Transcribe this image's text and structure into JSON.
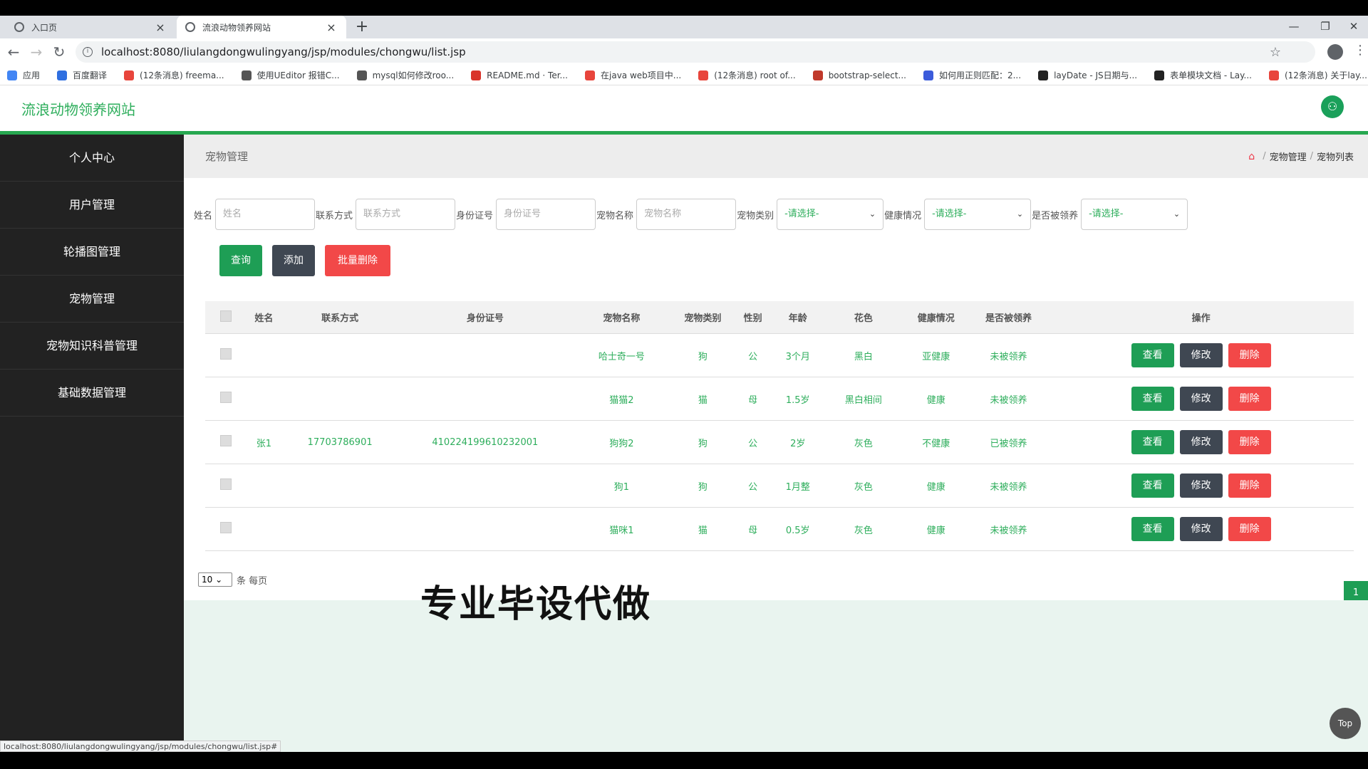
{
  "browser": {
    "tabs": [
      {
        "title": "入口页",
        "icon": "globe-icon"
      },
      {
        "title": "流浪动物领养网站",
        "icon": "site-icon"
      }
    ],
    "new_tab": "+",
    "url": "localhost:8080/liulangdongwulingyang/jsp/modules/chongwu/list.jsp",
    "bookmarks": [
      {
        "label": "应用",
        "color": "#4285f4"
      },
      {
        "label": "百度翻译",
        "color": "#2f6fe0"
      },
      {
        "label": "(12条消息) freema...",
        "color": "#e8453c"
      },
      {
        "label": "使用UEditor 报错C...",
        "color": "#555555"
      },
      {
        "label": "mysql如何修改roo...",
        "color": "#555555"
      },
      {
        "label": "README.md · Ter...",
        "color": "#d9342b"
      },
      {
        "label": "在java web项目中...",
        "color": "#e8453c"
      },
      {
        "label": "(12条消息) root of...",
        "color": "#e8453c"
      },
      {
        "label": "bootstrap-select...",
        "color": "#c0392b"
      },
      {
        "label": "如何用正则匹配：2...",
        "color": "#3b5bdb"
      },
      {
        "label": "layDate - JS日期与...",
        "color": "#222222"
      },
      {
        "label": "表单模块文档 - Lay...",
        "color": "#222222"
      },
      {
        "label": "(12条消息) 关于lay...",
        "color": "#e8453c"
      }
    ],
    "status_url": "localhost:8080/liulangdongwulingyang/jsp/modules/chongwu/list.jsp#"
  },
  "site": {
    "title": "流浪动物领养网站",
    "accent": "#27a850"
  },
  "sidebar": {
    "items": [
      "个人中心",
      "用户管理",
      "轮播图管理",
      "宠物管理",
      "宠物知识科普管理",
      "基础数据管理"
    ]
  },
  "content": {
    "title": "宠物管理",
    "breadcrumb": [
      "宠物管理",
      "宠物列表"
    ]
  },
  "filters": {
    "name_label": "姓名",
    "name_placeholder": "姓名",
    "phone_label": "联系方式",
    "phone_placeholder": "联系方式",
    "id_label": "身份证号",
    "id_placeholder": "身份证号",
    "pet_name_label": "宠物名称",
    "pet_name_placeholder": "宠物名称",
    "pet_type_label": "宠物类别",
    "pet_type_value": "-请选择-",
    "health_label": "健康情况",
    "health_value": "-请选择-",
    "adopted_label": "是否被领养",
    "adopted_value": "-请选择-"
  },
  "actions": {
    "query": "查询",
    "add": "添加",
    "batch_delete": "批量删除"
  },
  "table": {
    "headers": [
      "姓名",
      "联系方式",
      "身份证号",
      "宠物名称",
      "宠物类别",
      "性别",
      "年龄",
      "花色",
      "健康情况",
      "是否被领养",
      "操作"
    ],
    "rows": [
      [
        "",
        "",
        "",
        "哈士奇一号",
        "狗",
        "公",
        "3个月",
        "黑白",
        "亚健康",
        "未被领养"
      ],
      [
        "",
        "",
        "",
        "猫猫2",
        "猫",
        "母",
        "1.5岁",
        "黑白相间",
        "健康",
        "未被领养"
      ],
      [
        "张1",
        "17703786901",
        "410224199610232001",
        "狗狗2",
        "狗",
        "公",
        "2岁",
        "灰色",
        "不健康",
        "已被领养"
      ],
      [
        "",
        "",
        "",
        "狗1",
        "狗",
        "公",
        "1月整",
        "灰色",
        "健康",
        "未被领养"
      ],
      [
        "",
        "",
        "",
        "猫咪1",
        "猫",
        "母",
        "0.5岁",
        "灰色",
        "健康",
        "未被领养"
      ]
    ],
    "row_actions": {
      "view": "查看",
      "edit": "修改",
      "delete": "删除"
    }
  },
  "pager": {
    "page_size": "10",
    "per_page_text": "条 每页",
    "current_page": "1"
  },
  "overlay": {
    "watermark": "专业毕设代做",
    "top_button": "Top"
  }
}
